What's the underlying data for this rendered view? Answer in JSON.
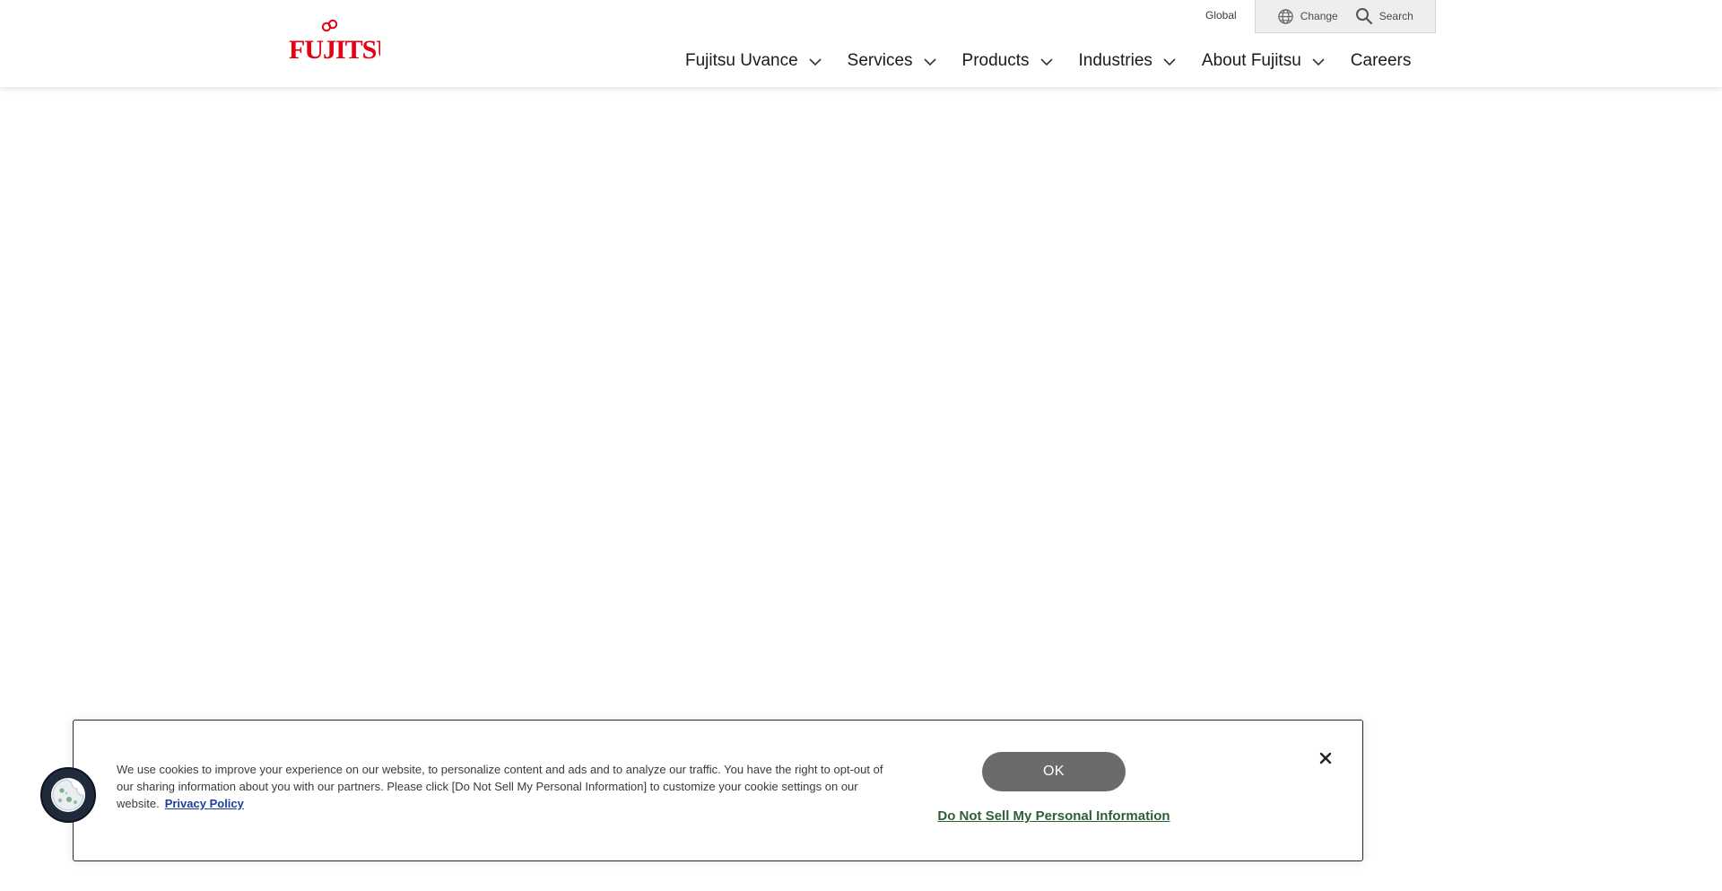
{
  "header": {
    "logo_text": "FUJITSU",
    "utility": {
      "region_label": "Global",
      "change_label": "Change",
      "search_label": "Search"
    },
    "nav": [
      {
        "label": "Fujitsu Uvance",
        "has_dropdown": true
      },
      {
        "label": "Services",
        "has_dropdown": true
      },
      {
        "label": "Products",
        "has_dropdown": true
      },
      {
        "label": "Industries",
        "has_dropdown": true
      },
      {
        "label": "About Fujitsu",
        "has_dropdown": true
      },
      {
        "label": "Careers",
        "has_dropdown": false
      }
    ]
  },
  "cookie_banner": {
    "message": "We use cookies to improve your experience on our website, to personalize content and ads and to analyze our traffic. You have the right to opt-out of our sharing information about you with our partners. Please click [Do Not Sell My Personal Information] to customize your cookie settings on our website.",
    "privacy_link": "Privacy Policy",
    "ok_label": "OK",
    "do_not_sell_label": "Do Not Sell My Personal Information",
    "close_icon": "close-icon",
    "settings_icon": "cookie-icon"
  },
  "colors": {
    "brand_red": "#e60012",
    "ok_button": "#6b6b6b",
    "privacy_link": "#1d3f99",
    "do_not_sell_link": "#2f5f3a",
    "utility_bg": "#eeeeee"
  }
}
